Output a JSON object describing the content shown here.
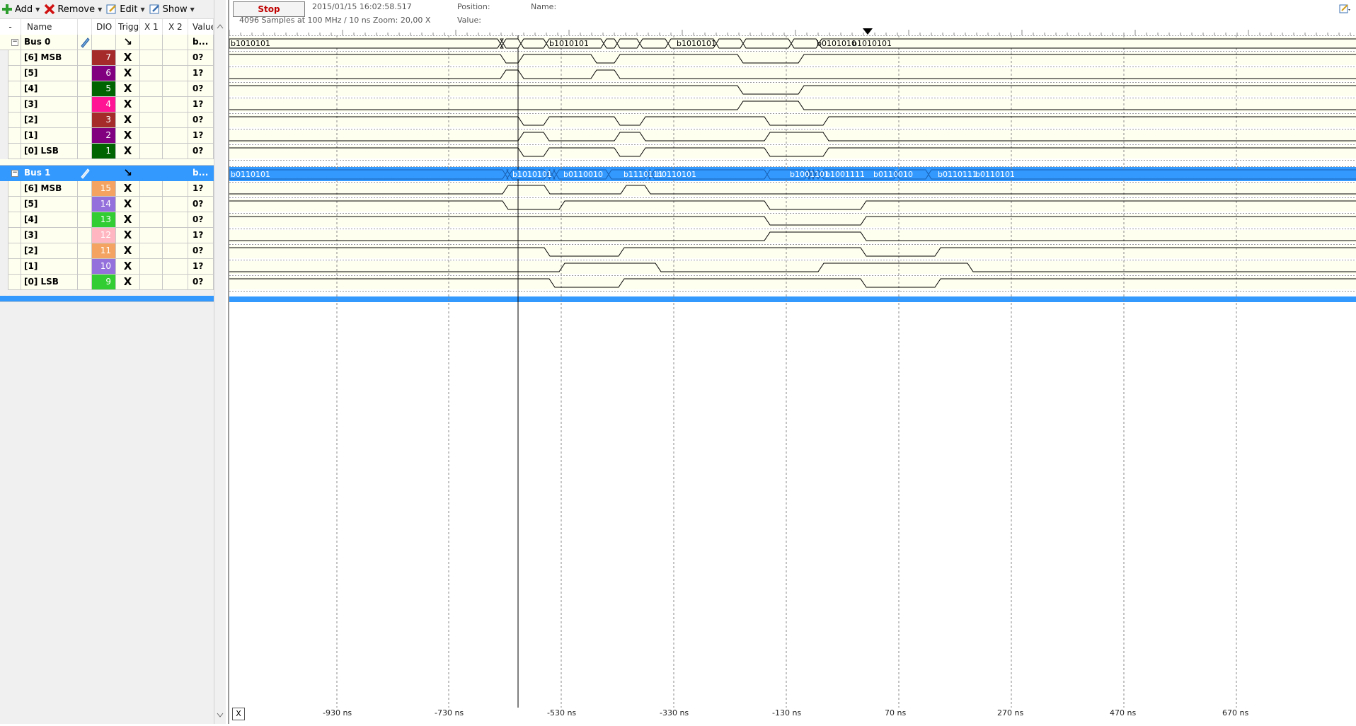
{
  "toolbar": {
    "add_label": "Add",
    "remove_label": "Remove",
    "edit_label": "Edit",
    "show_label": "Show"
  },
  "grid": {
    "headers": {
      "expand": "-",
      "name": "Name",
      "dio": "DIO",
      "trigger": "Trigge",
      "x1": "X 1",
      "x2": "X 2",
      "value": "Value"
    }
  },
  "bus0": {
    "name": "Bus 0",
    "value": "b...",
    "trigger": "↘",
    "channels": [
      {
        "name": "[6] MSB",
        "dio": "7",
        "color": "#a52a2a",
        "trigger": "X",
        "value": "0?"
      },
      {
        "name": "[5]",
        "dio": "6",
        "color": "#800080",
        "trigger": "X",
        "value": "1?"
      },
      {
        "name": "[4]",
        "dio": "5",
        "color": "#006400",
        "trigger": "X",
        "value": "0?"
      },
      {
        "name": "[3]",
        "dio": "4",
        "color": "#ff1493",
        "trigger": "X",
        "value": "1?"
      },
      {
        "name": "[2]",
        "dio": "3",
        "color": "#a52a2a",
        "trigger": "X",
        "value": "0?"
      },
      {
        "name": "[1]",
        "dio": "2",
        "color": "#800080",
        "trigger": "X",
        "value": "1?"
      },
      {
        "name": "[0] LSB",
        "dio": "1",
        "color": "#006400",
        "trigger": "X",
        "value": "0?"
      }
    ]
  },
  "bus1": {
    "name": "Bus 1",
    "value": "b...",
    "trigger": "↘",
    "channels": [
      {
        "name": "[6] MSB",
        "dio": "15",
        "color": "#f4a460",
        "trigger": "X",
        "value": "1?"
      },
      {
        "name": "[5]",
        "dio": "14",
        "color": "#9370db",
        "trigger": "X",
        "value": "0?"
      },
      {
        "name": "[4]",
        "dio": "13",
        "color": "#32cd32",
        "trigger": "X",
        "value": "0?"
      },
      {
        "name": "[3]",
        "dio": "12",
        "color": "#ffb6c1",
        "trigger": "X",
        "value": "1?"
      },
      {
        "name": "[2]",
        "dio": "11",
        "color": "#f4a460",
        "trigger": "X",
        "value": "0?"
      },
      {
        "name": "[1]",
        "dio": "10",
        "color": "#9370db",
        "trigger": "X",
        "value": "1?"
      },
      {
        "name": "[0] LSB",
        "dio": "9",
        "color": "#32cd32",
        "trigger": "X",
        "value": "0?"
      }
    ]
  },
  "header": {
    "stop_label": "Stop",
    "timestamp": "2015/01/15  16:02:58.517",
    "samples_info": "4096 Samples at 100 MHz / 10 ns Zoom: 20,00 X",
    "position_label": "Position:",
    "value_label": "Value:",
    "name_label": "Name:"
  },
  "bus0_segments": [
    "b1010101",
    "b1010101",
    "b1010101",
    "b0101010",
    "b1010101"
  ],
  "bus1_segments": [
    "b0110101",
    "b1010101",
    "b0110010",
    "b1110111",
    "b0110101",
    "b1001101",
    "b1001111",
    "b0110010",
    "b0110111",
    "b0110101"
  ],
  "time_axis": {
    "ticks": [
      "-930 ns",
      "-730 ns",
      "-530 ns",
      "-330 ns",
      "-130 ns",
      "70 ns",
      "270 ns",
      "470 ns",
      "670 ns"
    ]
  },
  "bottom_x_label": "X",
  "colors": {
    "selection": "#3399ff",
    "wave_bg": "#fffff0",
    "stop_text": "#c00000"
  }
}
